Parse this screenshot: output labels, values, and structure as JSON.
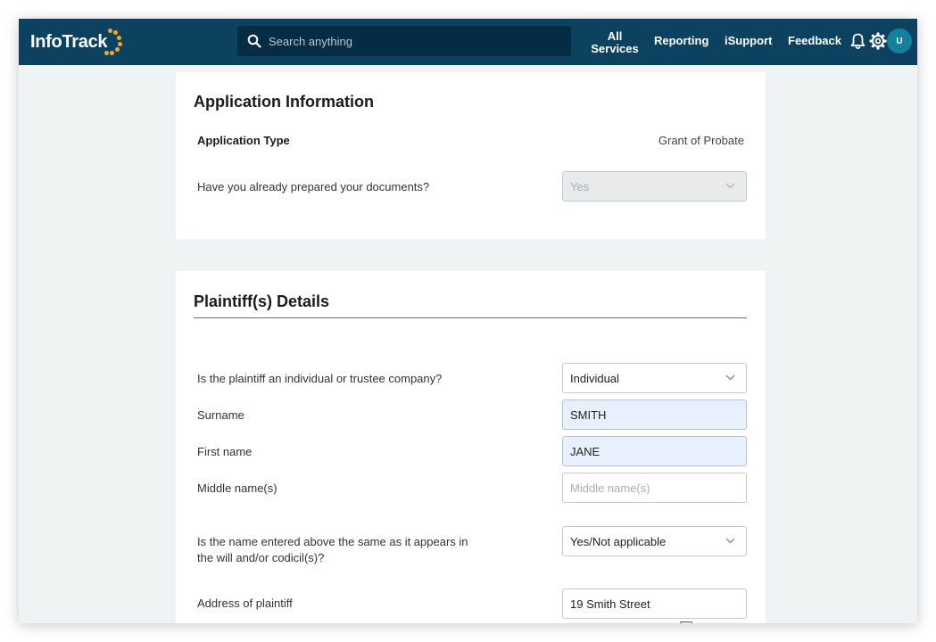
{
  "header": {
    "logo_text": "InfoTrack",
    "search_placeholder": "Search anything",
    "nav": {
      "all_services_line1": "All",
      "all_services_line2": "Services",
      "reporting": "Reporting",
      "isupport": "iSupport",
      "feedback": "Feedback"
    },
    "avatar_initial": "U",
    "icons": [
      "search-icon",
      "bell-icon",
      "gear-icon"
    ]
  },
  "application_info": {
    "title": "Application Information",
    "application_type_label": "Application Type",
    "application_type_value": "Grant of Probate",
    "documents_question": "Have you already prepared your documents?",
    "documents_answer": "Yes"
  },
  "plaintiff": {
    "title": "Plaintiff(s) Details",
    "type_question": "Is the plaintiff an individual or trustee company?",
    "type_value": "Individual",
    "surname_label": "Surname",
    "surname_value": "SMITH",
    "first_name_label": "First name",
    "first_name_value": "JANE",
    "middle_name_label": "Middle name(s)",
    "middle_name_placeholder": "Middle name(s)",
    "name_same_question_line1": "Is the name entered above the same as it appears in",
    "name_same_question_line2": "the will and/or codicil(s)?",
    "name_same_value": "Yes/Not applicable",
    "address_label": "Address of plaintiff",
    "address_value": "19 Smith Street"
  },
  "colors": {
    "header_bg": "#0c4160",
    "search_bg": "#052c45",
    "logo_accent": "#f7a823",
    "avatar_bg": "#15809b",
    "page_bg": "#f0f3f3",
    "autofill_bg": "#e8f0fe"
  }
}
